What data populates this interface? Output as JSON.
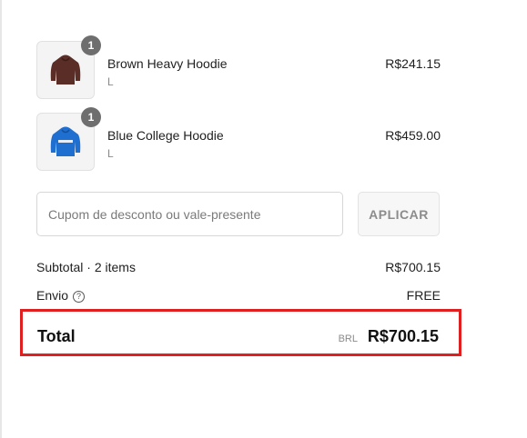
{
  "cart": {
    "items": [
      {
        "name": "Brown Heavy Hoodie",
        "variant": "L",
        "price": "R$241.15",
        "quantity": "1",
        "color": "#5a2d26",
        "icon": "brown-hoodie-icon"
      },
      {
        "name": "Blue College Hoodie",
        "variant": "L",
        "price": "R$459.00",
        "quantity": "1",
        "color": "#1f6fd0",
        "icon": "blue-hoodie-icon"
      }
    ]
  },
  "coupon": {
    "placeholder": "Cupom de desconto ou vale-presente",
    "value": "",
    "apply_label": "APLICAR"
  },
  "summary": {
    "subtotal_label": "Subtotal · 2 items",
    "subtotal_value": "R$700.15",
    "shipping_label": "Envio",
    "shipping_value": "FREE",
    "total_label": "Total",
    "currency_code": "BRL",
    "total_value": "R$700.15"
  },
  "colors": {
    "highlight": "#e02020",
    "badge": "#6e6e6e"
  }
}
